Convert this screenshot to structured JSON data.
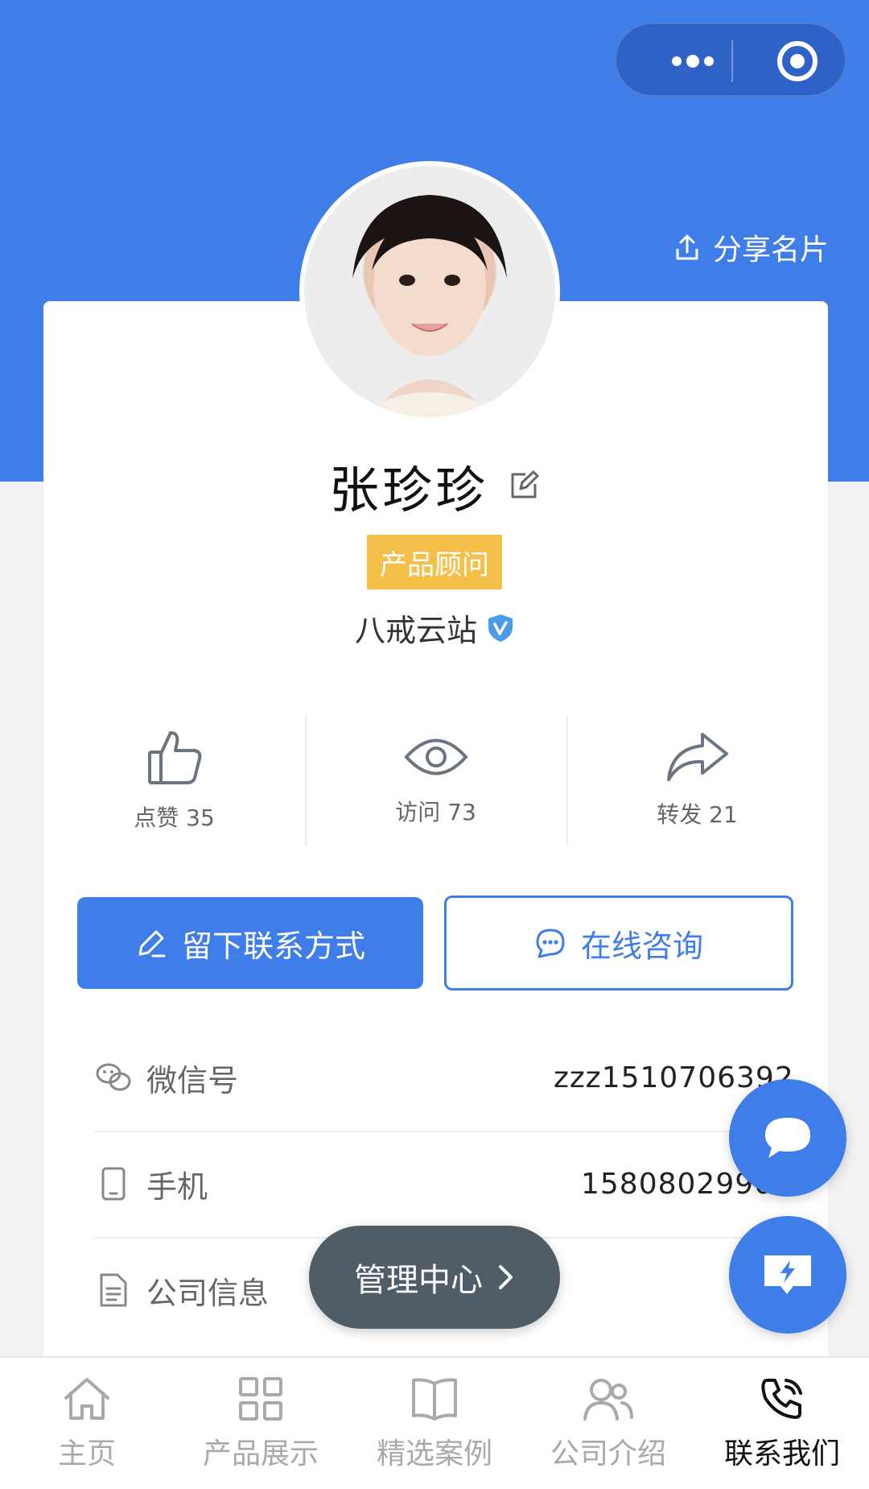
{
  "header": {
    "share_label": "分享名片"
  },
  "profile": {
    "name": "张珍珍",
    "title_badge": "产品顾问",
    "company": "八戒云站"
  },
  "stats": [
    {
      "label": "点赞 35",
      "icon": "thumbs-up-icon"
    },
    {
      "label": "访问 73",
      "icon": "eye-icon"
    },
    {
      "label": "转发 21",
      "icon": "share-arrow-icon"
    }
  ],
  "actions": {
    "leave_contact": "留下联系方式",
    "online_consult": "在线咨询"
  },
  "info_rows": [
    {
      "label": "微信号",
      "value": "zzz1510706392",
      "icon": "wechat-icon"
    },
    {
      "label": "手机",
      "value": "15808029907",
      "icon": "phone-icon"
    },
    {
      "label": "公司信息",
      "value": "",
      "icon": "document-icon"
    }
  ],
  "management_center": "管理中心",
  "tabbar": [
    {
      "label": "主页",
      "icon": "home-icon",
      "active": false
    },
    {
      "label": "产品展示",
      "icon": "grid-icon",
      "active": false
    },
    {
      "label": "精选案例",
      "icon": "book-icon",
      "active": false
    },
    {
      "label": "公司介绍",
      "icon": "people-icon",
      "active": false
    },
    {
      "label": "联系我们",
      "icon": "phone-call-icon",
      "active": true
    }
  ],
  "colors": {
    "primary": "#3f7ee8",
    "badge": "#f4c04a",
    "management_pill": "#505d66"
  }
}
